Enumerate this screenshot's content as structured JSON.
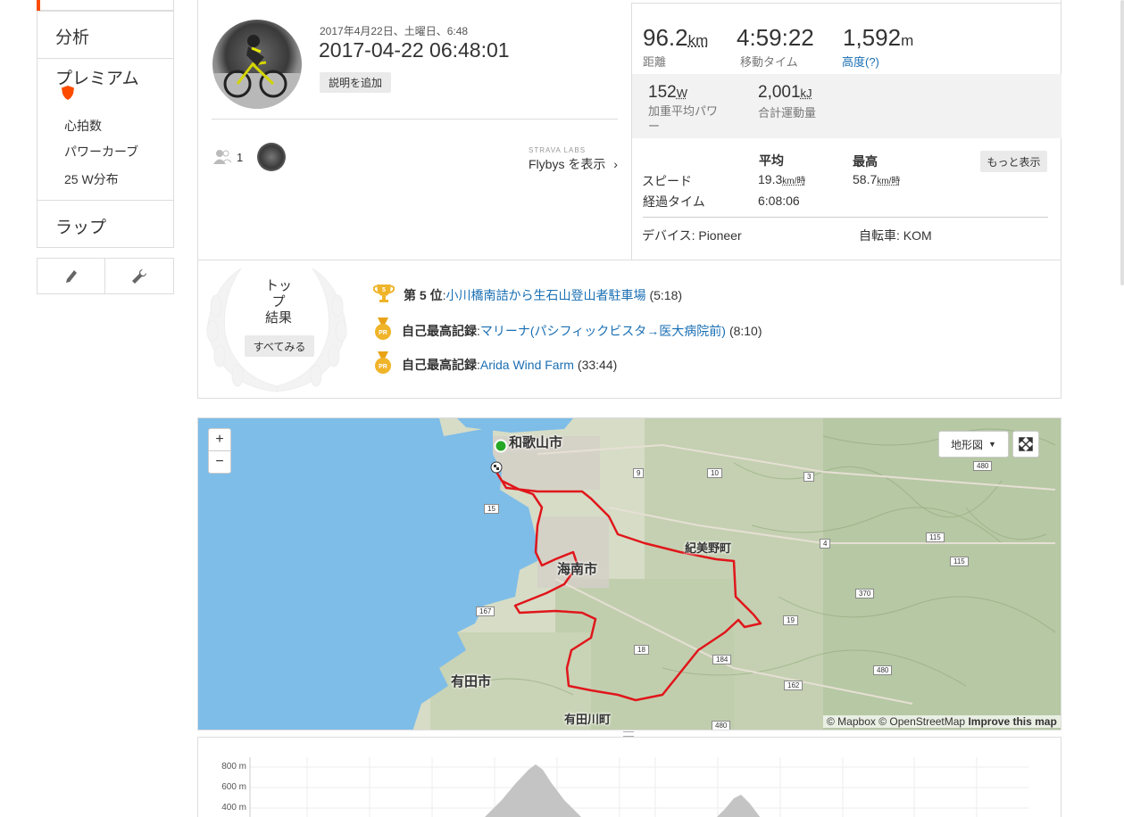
{
  "sidebar": {
    "analysis": "分析",
    "premium": "プレミアム",
    "premium_items": [
      "心拍数",
      "パワーカーブ",
      "25 W分布"
    ],
    "laps": "ラップ"
  },
  "activity": {
    "date_small": "2017年4月22日、土曜日、6:48",
    "title": "2017-04-22 06:48:01",
    "add_description": "説明を追加",
    "kudos_count": "1",
    "strava_labs": "STRAVA LABS",
    "flybys": "Flybys を表示"
  },
  "stats": {
    "distance_value": "96.2",
    "distance_unit": "km",
    "distance_label": "距離",
    "moving_time_value": "4:59:22",
    "moving_time_label": "移動タイム",
    "elevation_value": "1,592",
    "elevation_unit": "m",
    "elevation_label": "高度(?)",
    "power_value": "152",
    "power_unit": "W",
    "power_label": "加重平均パワー",
    "energy_value": "2,001",
    "energy_unit": "kJ",
    "energy_label": "合計運動量",
    "avg_header": "平均",
    "max_header": "最高",
    "show_more": "もっと表示",
    "speed_label": "スピード",
    "speed_avg": "19.3",
    "speed_max": "58.7",
    "speed_unit": "km/時",
    "elapsed_label": "経過タイム",
    "elapsed_value": "6:08:06",
    "device": "デバイス: Pioneer",
    "bike": "自転車: KOM"
  },
  "top_results": {
    "title_line1": "トップ",
    "title_line2": "結果",
    "see_all": "すべてみる",
    "items": [
      {
        "badge": "5",
        "rank": "第 5 位",
        "segment": "小川橋南詰から生石山登山者駐車場",
        "time": "(5:18)"
      },
      {
        "badge": "PR",
        "rank": "自己最高記録",
        "segment": "マリーナ(パシフィックビスタ→医大病院前)",
        "time": "(8:10)"
      },
      {
        "badge": "PR",
        "rank": "自己最高記録",
        "segment": "Arida Wind Farm",
        "time": "(33:44)"
      }
    ]
  },
  "map": {
    "zoom_in": "+",
    "zoom_out": "−",
    "layer": "地形図",
    "towns": [
      "和歌山市",
      "海南市",
      "紀美野町",
      "有田市",
      "有田川町"
    ],
    "attribution_mapbox": "© Mapbox",
    "attribution_osm": "© OpenStreetMap",
    "improve": "Improve this map",
    "route_color": "#e0161b",
    "water_color": "#7ebde8"
  },
  "elevation": {
    "labels": [
      "800 m",
      "600 m",
      "400 m"
    ]
  }
}
